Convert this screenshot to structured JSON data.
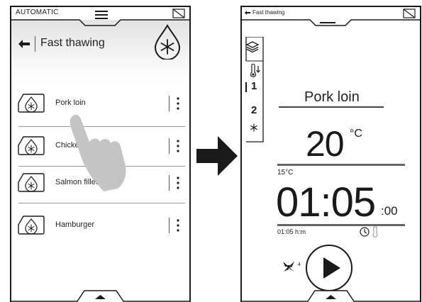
{
  "left_screen": {
    "mode_label": "AUTOMATIC",
    "title": "Fast thawing",
    "foods": [
      {
        "label": "Pork loin"
      },
      {
        "label": "Chicke"
      },
      {
        "label": "Salmon fillet"
      },
      {
        "label": "Hamburger"
      }
    ]
  },
  "right_screen": {
    "breadcrumb": "Fast thawing",
    "program_title": "Pork loin",
    "temperature": "20",
    "temperature_unit": "°C",
    "temperature_sub": "15°C",
    "time": "01:05",
    "time_seconds": ":00",
    "time_sub": "01:05 h:m",
    "levels": [
      "1",
      "2"
    ],
    "fan_level": "4"
  },
  "colors": {
    "ink": "#1a1a1a",
    "header_gradient_top": "#e3e3e3",
    "hand": "#c4c4c4"
  }
}
